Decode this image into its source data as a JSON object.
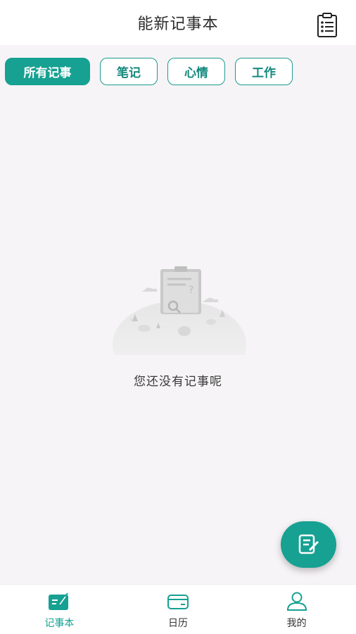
{
  "header": {
    "title": "能新记事本",
    "icon": "clipboard-list-icon"
  },
  "tabs": [
    {
      "label": "所有记事",
      "active": true
    },
    {
      "label": "笔记",
      "active": false
    },
    {
      "label": "心情",
      "active": false
    },
    {
      "label": "工作",
      "active": false
    }
  ],
  "empty_state": {
    "message": "您还没有记事呢",
    "icon": "empty-clipboard-illustration"
  },
  "fab": {
    "icon": "edit-note-icon"
  },
  "bottom_nav": [
    {
      "label": "记事本",
      "icon": "notebook-icon",
      "active": true
    },
    {
      "label": "日历",
      "icon": "calendar-card-icon",
      "active": false
    },
    {
      "label": "我的",
      "icon": "user-icon",
      "active": false
    }
  ],
  "colors": {
    "accent": "#16a192",
    "background": "#f6f4f6"
  }
}
